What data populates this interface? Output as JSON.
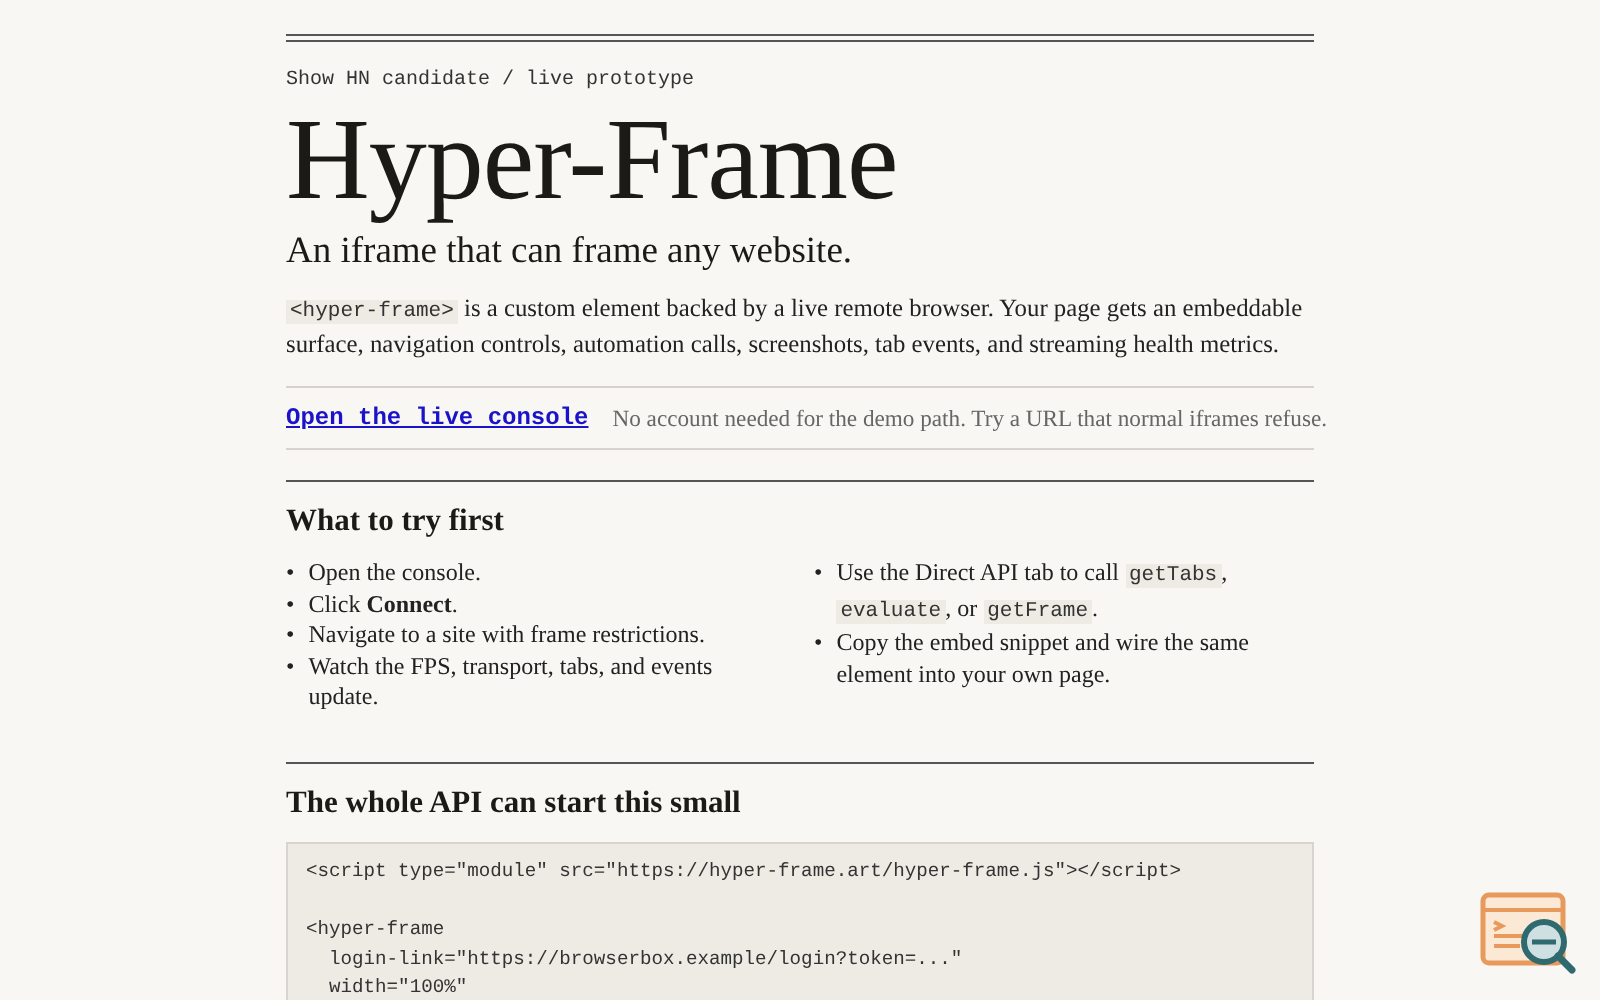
{
  "eyebrow": "Show HN candidate / live prototype",
  "title": "Hyper-Frame",
  "tagline": "An iframe that can frame any website.",
  "intro": [
    {
      "kind": "code",
      "text": "<hyper-frame>"
    },
    {
      "kind": "text",
      "text": " is a custom element backed by a live remote browser. Your page gets an embeddable surface, navigation controls, automation calls, screenshots, tab events, and streaming health metrics."
    }
  ],
  "cta": {
    "link": "Open the live console",
    "note": "No account needed for the demo path. Try a URL that normal iframes refuse."
  },
  "try_first": {
    "heading": "What to try first",
    "columns": [
      [
        {
          "bullet": "•",
          "parts": [
            {
              "kind": "text",
              "text": "Open the console."
            }
          ]
        },
        {
          "bullet": "•",
          "parts": [
            {
              "kind": "text",
              "text": "Click **Connect**."
            }
          ]
        },
        {
          "bullet": "•",
          "parts": [
            {
              "kind": "text",
              "text": "Navigate to a site with frame restrictions."
            }
          ]
        },
        {
          "bullet": "•",
          "parts": [
            {
              "kind": "text",
              "text": "Watch the FPS, transport, tabs, and events update."
            }
          ]
        }
      ],
      [
        {
          "bullet": "•",
          "parts": [
            {
              "kind": "text",
              "text": "Use the Direct API tab to call "
            },
            {
              "kind": "code",
              "text": "getTabs"
            },
            {
              "kind": "text",
              "text": ", "
            },
            {
              "kind": "code",
              "text": "evaluate"
            },
            {
              "kind": "text",
              "text": ", or "
            },
            {
              "kind": "code",
              "text": "getFrame"
            },
            {
              "kind": "text",
              "text": "."
            }
          ]
        },
        {
          "bullet": "•",
          "parts": [
            {
              "kind": "text",
              "text": "Copy the embed snippet and wire the same element into your own page."
            }
          ]
        }
      ]
    ]
  },
  "api": {
    "heading": "The whole API can start this small",
    "code_blocks": [
      [
        "<script type=\"module\" src=\"https://hyper-frame.art/hyper-frame.js\"></script>"
      ],
      [
        "<hyper-frame",
        "  login-link=\"https://browserbox.example/login?token=...\"",
        "  width=\"100%\""
      ]
    ]
  }
}
